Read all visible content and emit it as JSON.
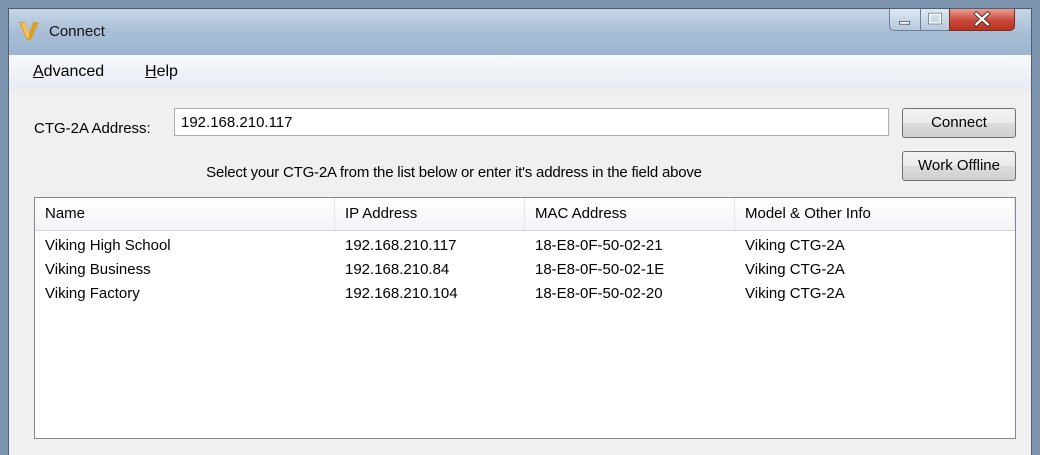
{
  "window": {
    "title": "Connect",
    "icon": "viking-v-logo",
    "controls": [
      "minimize-icon",
      "maximize-icon",
      "close-icon"
    ]
  },
  "menu": {
    "items": [
      {
        "label": "Advanced",
        "accel": "A",
        "rest": "dvanced"
      },
      {
        "label": "Help",
        "accel": "H",
        "rest": "elp"
      }
    ]
  },
  "address": {
    "label": "CTG-2A Address:",
    "value": "192.168.210.117"
  },
  "buttons": {
    "connect": "Connect",
    "work_offline": "Work Offline"
  },
  "hint": "Select your CTG-2A from the list below or enter it's address in the field above",
  "devices": {
    "columns": [
      "Name",
      "IP Address",
      "MAC Address",
      "Model & Other Info"
    ],
    "rows": [
      [
        "Viking High School",
        "192.168.210.117",
        "18-E8-0F-50-02-21",
        "Viking CTG-2A"
      ],
      [
        "Viking Business",
        "192.168.210.84",
        "18-E8-0F-50-02-1E",
        "Viking CTG-2A"
      ],
      [
        "Viking Factory",
        "192.168.210.104",
        "18-E8-0F-50-02-20",
        "Viking CTG-2A"
      ]
    ]
  },
  "colors": {
    "logo": "#d9a12b",
    "close_button": "#c9483a",
    "titlebar": "#a9bfd7"
  }
}
